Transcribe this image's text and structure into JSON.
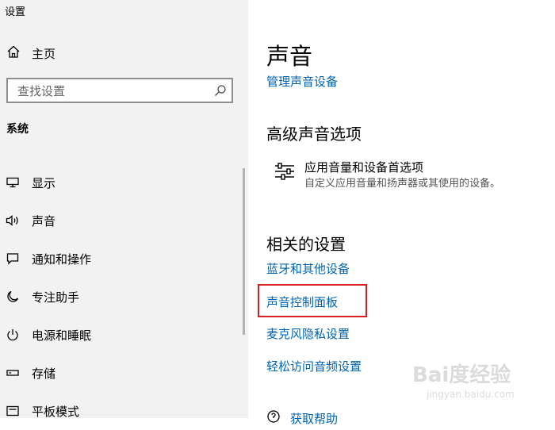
{
  "window": {
    "title": "设置"
  },
  "sidebar": {
    "home_label": "主页",
    "search_placeholder": "查找设置",
    "section_label": "系统",
    "items": [
      {
        "label": "显示",
        "icon": "monitor-icon"
      },
      {
        "label": "声音",
        "icon": "speaker-icon"
      },
      {
        "label": "通知和操作",
        "icon": "notification-icon"
      },
      {
        "label": "专注助手",
        "icon": "moon-icon"
      },
      {
        "label": "电源和睡眠",
        "icon": "power-icon"
      },
      {
        "label": "存储",
        "icon": "storage-icon"
      },
      {
        "label": "平板模式",
        "icon": "tablet-icon"
      }
    ]
  },
  "main": {
    "title": "声音",
    "manage_link": "管理声音设备",
    "advanced_heading": "高级声音选项",
    "advanced_item": {
      "title": "应用音量和设备首选项",
      "description": "自定义应用音量和扬声器或其使用的设备。",
      "icon": "sliders-icon"
    },
    "related_heading": "相关的设置",
    "related_links": [
      "蓝牙和其他设备",
      "声音控制面板",
      "麦克风隐私设置",
      "轻松访问音频设置"
    ],
    "help_link": "获取帮助"
  },
  "watermark": {
    "brand": "Bai度经验",
    "sub": "jingyan.baidu.com"
  },
  "colors": {
    "link": "#0063b1",
    "sidebar_bg": "#f2f2f2",
    "highlight": "#d81e1e"
  }
}
